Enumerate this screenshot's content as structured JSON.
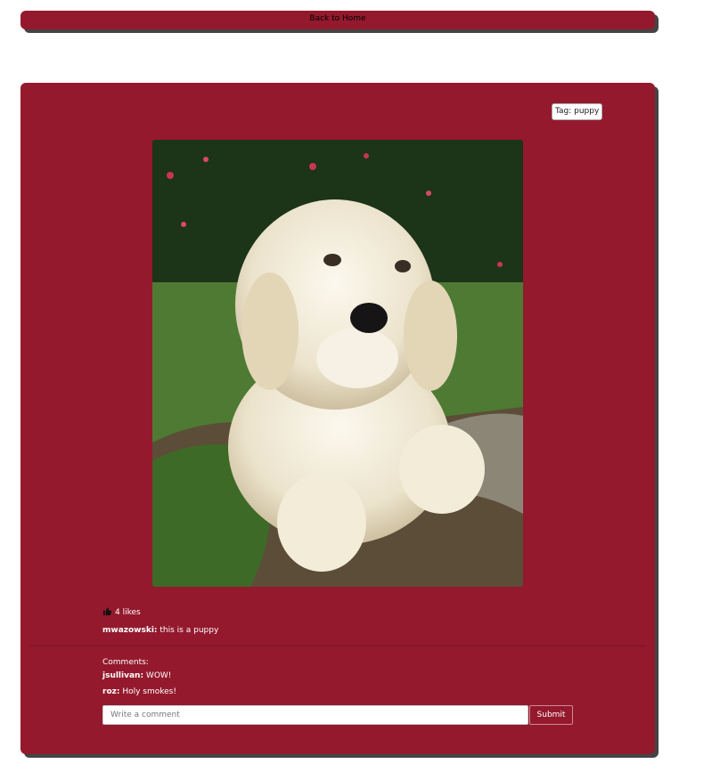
{
  "nav": {
    "back_label": "Back to Home"
  },
  "post": {
    "tag_label": "Tag: puppy",
    "image_alt": "puppy",
    "likes_text": "4 likes",
    "author": "mwazowski:",
    "caption": " this is a puppy"
  },
  "comments": {
    "title": "Comments:",
    "items": [
      {
        "user": "jsullivan:",
        "text": " WOW!"
      },
      {
        "user": "roz:",
        "text": " Holy smokes!"
      }
    ]
  },
  "comment_form": {
    "placeholder": "Write a comment",
    "value": "",
    "submit_label": "Submit"
  },
  "icons": {
    "like": "thumbs-up-icon"
  },
  "colors": {
    "card_background": "#94192d",
    "shadow": "#444444"
  }
}
